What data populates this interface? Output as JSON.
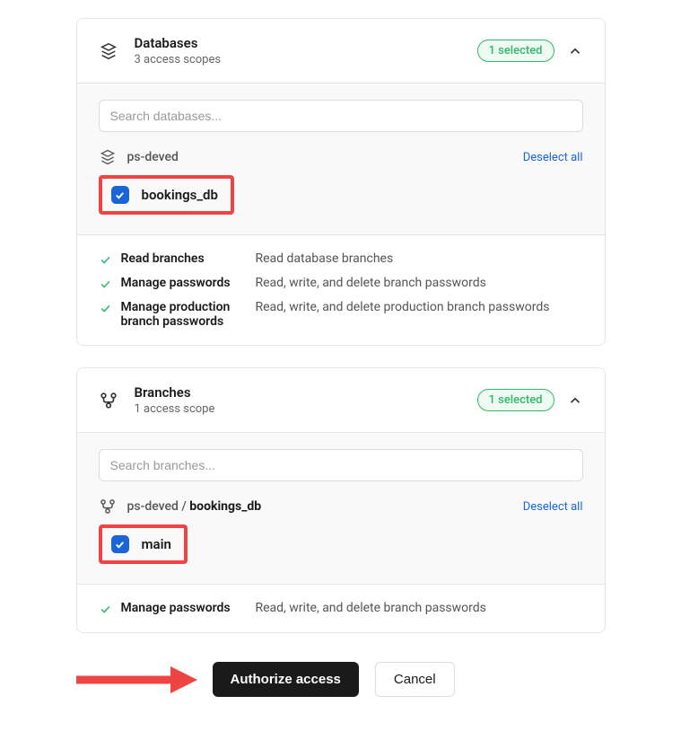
{
  "databases": {
    "title": "Databases",
    "subtitle": "3 access scopes",
    "badge": "1 selected",
    "search_placeholder": "Search databases...",
    "org_name": "ps-deved",
    "deselect_label": "Deselect all",
    "selected_db": "bookings_db",
    "scopes": [
      {
        "name": "Read branches",
        "desc": "Read database branches"
      },
      {
        "name": "Manage passwords",
        "desc": "Read, write, and delete branch passwords"
      },
      {
        "name": "Manage production branch passwords",
        "desc": "Read, write, and delete production branch passwords"
      }
    ]
  },
  "branches": {
    "title": "Branches",
    "subtitle": "1 access scope",
    "badge": "1 selected",
    "search_placeholder": "Search branches...",
    "path_prefix": "ps-deved / ",
    "path_db": "bookings_db",
    "deselect_label": "Deselect all",
    "selected_branch": "main",
    "scopes": [
      {
        "name": "Manage passwords",
        "desc": "Read, write, and delete branch passwords"
      }
    ]
  },
  "actions": {
    "authorize": "Authorize access",
    "cancel": "Cancel"
  }
}
